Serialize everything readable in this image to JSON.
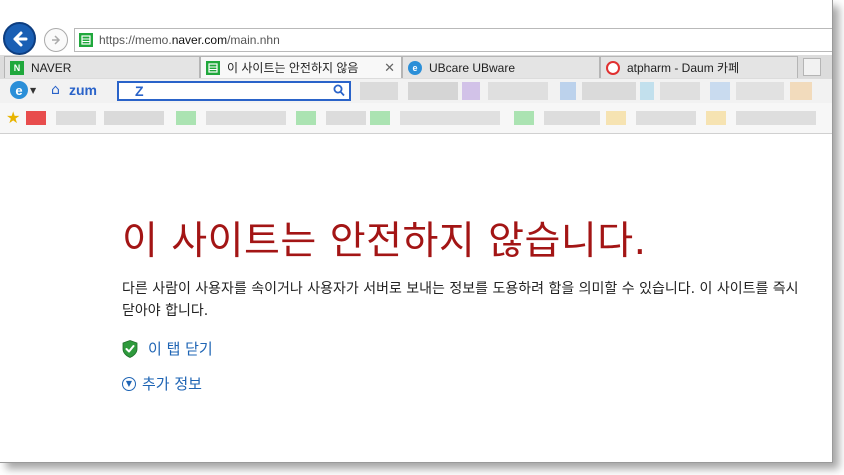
{
  "browser": {
    "url_prefix": "https://memo.",
    "url_host": "naver.com",
    "url_path": "/main.nhn"
  },
  "tabs": [
    {
      "label": "NAVER",
      "icon": "naver-icon",
      "color": "#20a83c"
    },
    {
      "label": "이 사이트는 안전하지 않음",
      "icon": "naver-memo-icon",
      "color": "#20a83c",
      "active": true
    },
    {
      "label": "UBcare UBware",
      "icon": "ie-page-icon",
      "color": "#2b8fd8"
    },
    {
      "label": "atpharm - Daum 카페",
      "icon": "daum-icon",
      "color": "#e03030"
    }
  ],
  "toolbar": {
    "ie_label": "e",
    "zum_label": "zum",
    "search_logo": "Z"
  },
  "content": {
    "title": "이 사이트는 안전하지 않습니다.",
    "body": "다른 사람이 사용자를 속이거나 사용자가 서버로 보내는 정보를 도용하려 함을 의미할 수 있습니다. 이 사이트를 즉시 닫아야 합니다.",
    "close_tab_link": "이 탭 닫기",
    "more_info_link": "추가 정보"
  },
  "colors": {
    "title_red": "#a31515",
    "link_blue": "#1e64b4",
    "brand_blue": "#2a63c9"
  }
}
